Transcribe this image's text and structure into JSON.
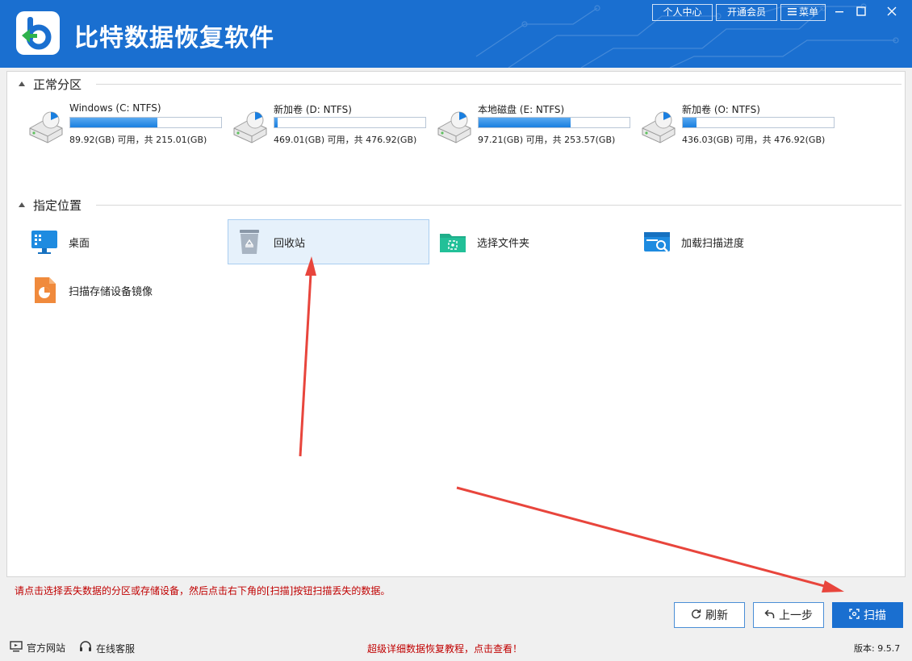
{
  "app": {
    "title": "比特数据恢复软件"
  },
  "titlebar": {
    "user_center": "个人中心",
    "vip": "开通会员",
    "menu": "菜单"
  },
  "sections": {
    "partitions": "正常分区",
    "locations": "指定位置"
  },
  "drives": [
    {
      "name": "Windows (C: NTFS)",
      "info": "89.92(GB) 可用，共 215.01(GB)",
      "used_fraction": 0.58
    },
    {
      "name": "新加卷 (D: NTFS)",
      "info": "469.01(GB) 可用，共 476.92(GB)",
      "used_fraction": 0.02
    },
    {
      "name": "本地磁盘 (E: NTFS)",
      "info": "97.21(GB) 可用，共 253.57(GB)",
      "used_fraction": 0.61
    },
    {
      "name": "新加卷 (O: NTFS)",
      "info": "436.03(GB) 可用，共 476.92(GB)",
      "used_fraction": 0.09
    }
  ],
  "locations": [
    {
      "label": "桌面",
      "icon": "desktop-icon"
    },
    {
      "label": "回收站",
      "icon": "recycle-bin-icon",
      "selected": true
    },
    {
      "label": "选择文件夹",
      "icon": "folder-icon"
    },
    {
      "label": "加载扫描进度",
      "icon": "load-progress-icon"
    },
    {
      "label": "扫描存储设备镜像",
      "icon": "disk-image-icon"
    }
  ],
  "hint": "请点击选择丢失数据的分区或存储设备，然后点击右下角的[扫描]按钮扫描丢失的数据。",
  "buttons": {
    "refresh": "刷新",
    "back": "上一步",
    "scan": "扫描"
  },
  "footer": {
    "site": "官方网站",
    "service": "在线客服",
    "promo": "超级详细数据恢复教程，点击查看！",
    "version": "版本: 9.5.7"
  },
  "colors": {
    "brand": "#1a6fd0",
    "alert": "#c00000",
    "annotation_arrow": "#e8453c"
  }
}
